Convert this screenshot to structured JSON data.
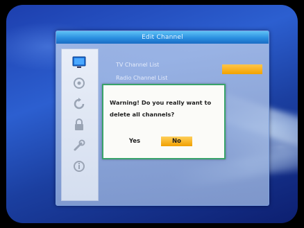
{
  "window": {
    "title": "Edit Channel"
  },
  "menu": {
    "items": [
      {
        "label": "TV Channel List"
      },
      {
        "label": "Radio Channel List"
      }
    ]
  },
  "sidebar": {
    "icons": [
      "tv-icon",
      "satellite-icon",
      "refresh-icon",
      "lock-icon",
      "tools-icon",
      "info-icon"
    ]
  },
  "dialog": {
    "message_line1": "Warning! Do you really want to",
    "message_line2": "delete all channels?",
    "yes_label": "Yes",
    "no_label": "No",
    "selected": "No"
  },
  "colors": {
    "title_bar": "#2a8fe0",
    "highlight": "#f2a200",
    "dialog_border": "#39a36a",
    "background": "#1d3fae"
  }
}
